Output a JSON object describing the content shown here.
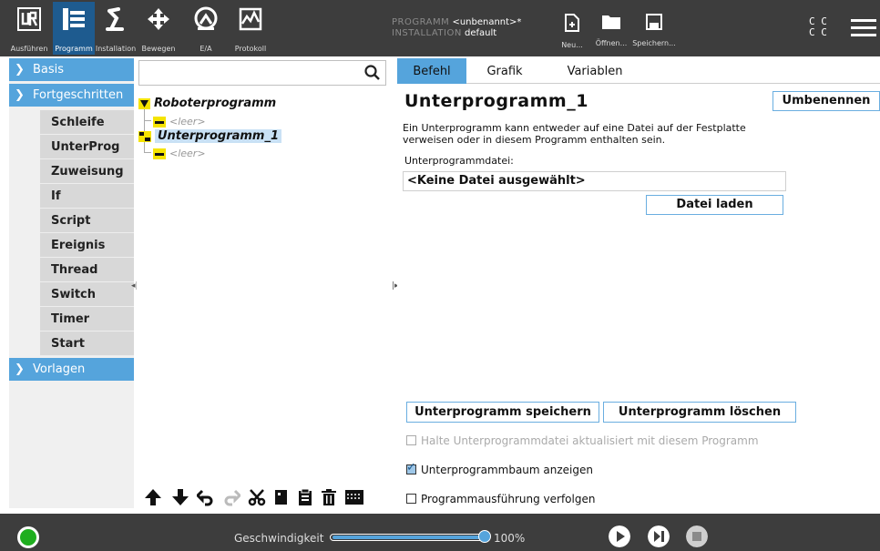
{
  "topnav": {
    "items": [
      {
        "label": "Ausführen",
        "icon": "ur-logo-icon"
      },
      {
        "label": "Programm",
        "icon": "program-tree-icon",
        "active": true
      },
      {
        "label": "Installation",
        "icon": "robot-arm-icon"
      },
      {
        "label": "Bewegen",
        "icon": "move-arrows-icon"
      },
      {
        "label": "E/A",
        "icon": "io-icon"
      },
      {
        "label": "Protokoll",
        "icon": "log-icon"
      }
    ],
    "program_key": "PROGRAMM",
    "program_value": "<unbenannt>*",
    "installation_key": "INSTALLATION",
    "installation_value": "default",
    "file_buttons": [
      {
        "label": "Neu...",
        "icon": "new-file-icon"
      },
      {
        "label": "Öffnen...",
        "icon": "folder-icon"
      },
      {
        "label": "Speichern...",
        "icon": "save-icon"
      }
    ],
    "cc_line1": "C C",
    "cc_line2": "C C"
  },
  "sidebar": {
    "categories": [
      {
        "label": "Basis",
        "expanded": false
      },
      {
        "label": "Fortgeschritten",
        "expanded": true
      },
      {
        "label": "Vorlagen",
        "expanded": false
      }
    ],
    "advanced_items": [
      "Schleife",
      "UnterProg",
      "Zuweisung",
      "If",
      "Script",
      "Ereignis",
      "Thread",
      "Switch",
      "Timer",
      "Start"
    ]
  },
  "tree": {
    "search_placeholder": "",
    "root_label": "Roboterprogramm",
    "empty_label": "<leer>",
    "subprogram_label": "Unterprogramm_1",
    "sub_empty_label": "<leer>"
  },
  "tabs": [
    "Befehl",
    "Grafik",
    "Variablen"
  ],
  "command": {
    "title": "Unterprogramm_1",
    "rename_label": "Umbenennen",
    "description": "Ein Unterprogramm kann entweder auf eine Datei auf der Festplatte verweisen oder in diesem Programm enthalten sein.",
    "file_label": "Unterprogrammdatei:",
    "file_value": "<Keine Datei ausgewählt>",
    "load_label": "Datei laden",
    "save_sub_label": "Unterprogramm speichern",
    "delete_sub_label": "Unterprogramm löschen",
    "checkbox_keep_updated": "Halte Unterprogrammdatei aktualisiert mit diesem Programm",
    "checkbox_show_tree": "Unterprogrammbaum anzeigen",
    "checkbox_follow": "Programmausführung verfolgen",
    "keep_updated_checked": false,
    "show_tree_checked": true,
    "follow_checked": false
  },
  "bottom": {
    "speed_label": "Geschwindigkeit",
    "speed_percent": 100,
    "speed_value": "100%"
  },
  "colors": {
    "accent": "#55a4dc",
    "topbar": "#3d3d3d",
    "active_nav": "#1e5b8f",
    "tree_marker": "#f5e400",
    "power_on": "#1fae1f"
  }
}
